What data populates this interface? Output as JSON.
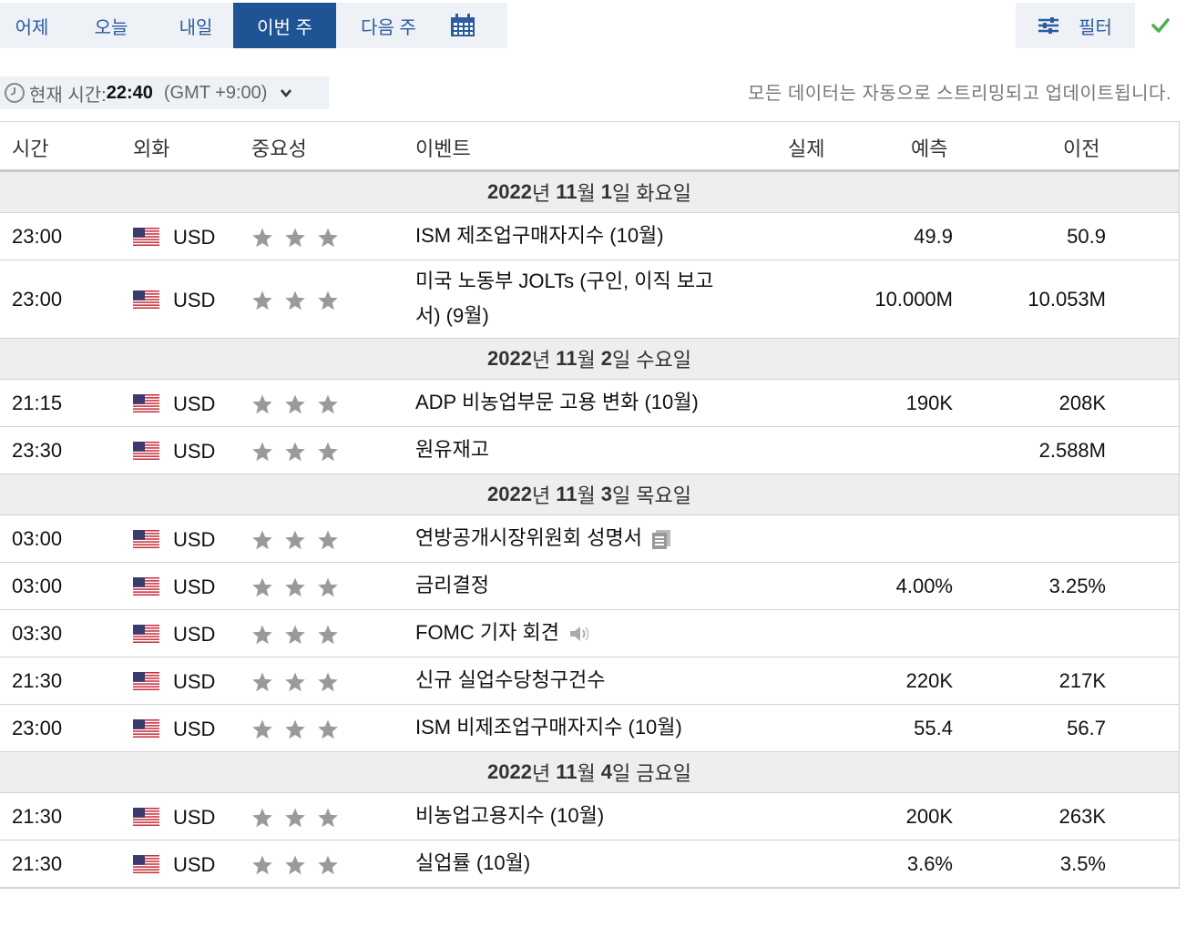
{
  "tabs": [
    {
      "label": "어제",
      "active": false
    },
    {
      "label": "오늘",
      "active": false
    },
    {
      "label": "내일",
      "active": false
    },
    {
      "label": "이번 주",
      "active": true
    },
    {
      "label": "다음 주",
      "active": false
    }
  ],
  "calendar_icon": "calendar-icon",
  "filter": {
    "label": "필터",
    "icon": "sliders-icon"
  },
  "status_icon": "check-icon",
  "time_bar": {
    "label": "현재 시간:",
    "time": "22:40",
    "timezone": "(GMT +9:00)",
    "icon": "clock-icon"
  },
  "streaming_note": "모든 데이터는 자동으로 스트리밍되고 업데이트됩니다.",
  "columns": {
    "time": "시간",
    "currency": "외화",
    "importance": "중요성",
    "event": "이벤트",
    "actual": "실제",
    "forecast": "예측",
    "previous": "이전"
  },
  "days": [
    {
      "year": "2022",
      "year_suffix": "년",
      "month": "11",
      "month_suffix": "월",
      "day": "1",
      "day_suffix": "일",
      "weekday": "화요일",
      "events": [
        {
          "time": "23:00",
          "currency": "USD",
          "importance": 3,
          "event": "ISM 제조업구매자지수 (10월)",
          "actual": "",
          "forecast": "49.9",
          "previous": "50.9",
          "previous_bold": false
        },
        {
          "time": "23:00",
          "currency": "USD",
          "importance": 3,
          "event": "미국 노동부 JOLTs (구인, 이직 보고서) (9월)",
          "actual": "",
          "forecast": "10.000M",
          "previous": "10.053M",
          "previous_bold": false
        }
      ]
    },
    {
      "year": "2022",
      "year_suffix": "년",
      "month": "11",
      "month_suffix": "월",
      "day": "2",
      "day_suffix": "일",
      "weekday": "수요일",
      "events": [
        {
          "time": "21:15",
          "currency": "USD",
          "importance": 3,
          "event": "ADP 비농업부문 고용 변화 (10월)",
          "actual": "",
          "forecast": "190K",
          "previous": "208K",
          "previous_bold": true
        },
        {
          "time": "23:30",
          "currency": "USD",
          "importance": 3,
          "event": "원유재고",
          "actual": "",
          "forecast": "",
          "previous": "2.588M",
          "previous_bold": true
        }
      ]
    },
    {
      "year": "2022",
      "year_suffix": "년",
      "month": "11",
      "month_suffix": "월",
      "day": "3",
      "day_suffix": "일",
      "weekday": "목요일",
      "events": [
        {
          "time": "03:00",
          "currency": "USD",
          "importance": 3,
          "event": "연방공개시장위원회 성명서",
          "event_icon": "document-icon",
          "actual": "",
          "forecast": "",
          "previous": "",
          "previous_bold": false
        },
        {
          "time": "03:00",
          "currency": "USD",
          "importance": 3,
          "event": "금리결정",
          "actual": "",
          "forecast": "4.00%",
          "previous": "3.25%",
          "previous_bold": false
        },
        {
          "time": "03:30",
          "currency": "USD",
          "importance": 3,
          "event": "FOMC 기자 회견",
          "event_icon": "speaker-icon",
          "actual": "",
          "forecast": "",
          "previous": "",
          "previous_bold": false
        },
        {
          "time": "21:30",
          "currency": "USD",
          "importance": 3,
          "event": "신규 실업수당청구건수",
          "actual": "",
          "forecast": "220K",
          "previous": "217K",
          "previous_bold": false
        },
        {
          "time": "23:00",
          "currency": "USD",
          "importance": 3,
          "event": "ISM 비제조업구매자지수 (10월)",
          "actual": "",
          "forecast": "55.4",
          "previous": "56.7",
          "previous_bold": false
        }
      ]
    },
    {
      "year": "2022",
      "year_suffix": "년",
      "month": "11",
      "month_suffix": "월",
      "day": "4",
      "day_suffix": "일",
      "weekday": "금요일",
      "events": [
        {
          "time": "21:30",
          "currency": "USD",
          "importance": 3,
          "event": "비농업고용지수 (10월)",
          "actual": "",
          "forecast": "200K",
          "previous": "263K",
          "previous_bold": true
        },
        {
          "time": "21:30",
          "currency": "USD",
          "importance": 3,
          "event": "실업률 (10월)",
          "actual": "",
          "forecast": "3.6%",
          "previous": "3.5%",
          "previous_bold": false
        }
      ]
    }
  ],
  "colors": {
    "tab_active": "#1f5494",
    "link": "#2b5d9e",
    "star": "#9a9a9a",
    "check": "#4caf50"
  }
}
